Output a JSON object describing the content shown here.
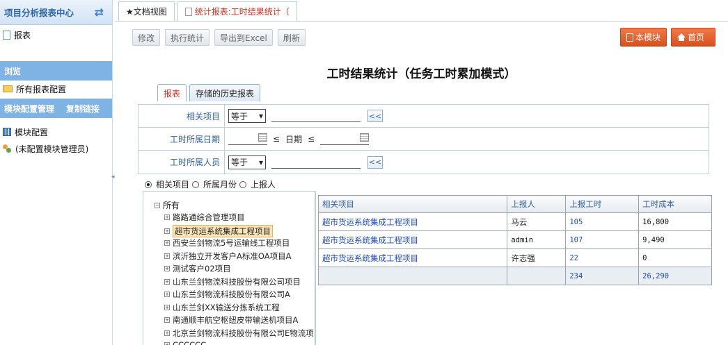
{
  "sidebar": {
    "title": "项目分析报表中心",
    "report_item": "报表",
    "browse_section": "浏览",
    "all_report_config": "所有报表配置",
    "module_section": "模块配置管理",
    "copy_link": "复制链接",
    "module_config": "模块配置",
    "no_admin": "(未配置模块管理员)"
  },
  "tabs": [
    {
      "label": "★文档视图"
    },
    {
      "label": "统计报表:工时结果统计（"
    }
  ],
  "toolbar": {
    "modify": "修改",
    "execute": "执行统计",
    "export": "导出到Excel",
    "refresh": "刷新",
    "this_module": "本模块",
    "home": "首页"
  },
  "report": {
    "title": "工时结果统计（任务工时累加模式）",
    "tab_report": "报表",
    "tab_history": "存储的历史报表"
  },
  "filters": {
    "project_label": "相关项目",
    "project_op": "等于",
    "date_label": "工时所属日期",
    "date_le_left": "≤",
    "date_word": "日期",
    "date_le_right": "≤",
    "person_label": "工时所属人员",
    "person_op": "等于",
    "chev": "<<"
  },
  "grouping": {
    "options": [
      "相关项目",
      "所属月份",
      "上报人"
    ],
    "selected": "相关项目"
  },
  "tree": {
    "root": "所有",
    "nodes": [
      "路路通综合管理项目",
      "超市货运系统集成工程项目",
      "西安兰剑物流5号运输线工程项目",
      "滨沂独立开发客户A标准OA项目A",
      "测试客户02项目",
      "山东兰剑物流科技股份有限公司项目",
      "山东兰剑物流科技股份有限公司A",
      "山东兰剑XX输送分拣系统工程",
      "南通顺丰航空枢纽皮带输送机项目A",
      "北京兰剑物流科技股份有限公司E物流项目",
      "CCCCCC"
    ],
    "selected_index": 1
  },
  "table": {
    "headers": [
      "相关项目",
      "上报人",
      "上报工时",
      "工时成本"
    ],
    "rows": [
      {
        "project": "超市货运系统集成工程项目",
        "reporter": "马云",
        "hours": "105",
        "cost": "16,800"
      },
      {
        "project": "超市货运系统集成工程项目",
        "reporter": "admin",
        "hours": "107",
        "cost": "9,490"
      },
      {
        "project": "超市货运系统集成工程项目",
        "reporter": "许志强",
        "hours": "22",
        "cost": "0"
      }
    ],
    "total": {
      "hours": "234",
      "cost": "26,290"
    }
  },
  "colors": {
    "sidebar_section": "#7fb2e5",
    "accent_orange": "#e2612e",
    "link_blue": "#1c48c4",
    "label_blue": "#2e5fa0"
  }
}
